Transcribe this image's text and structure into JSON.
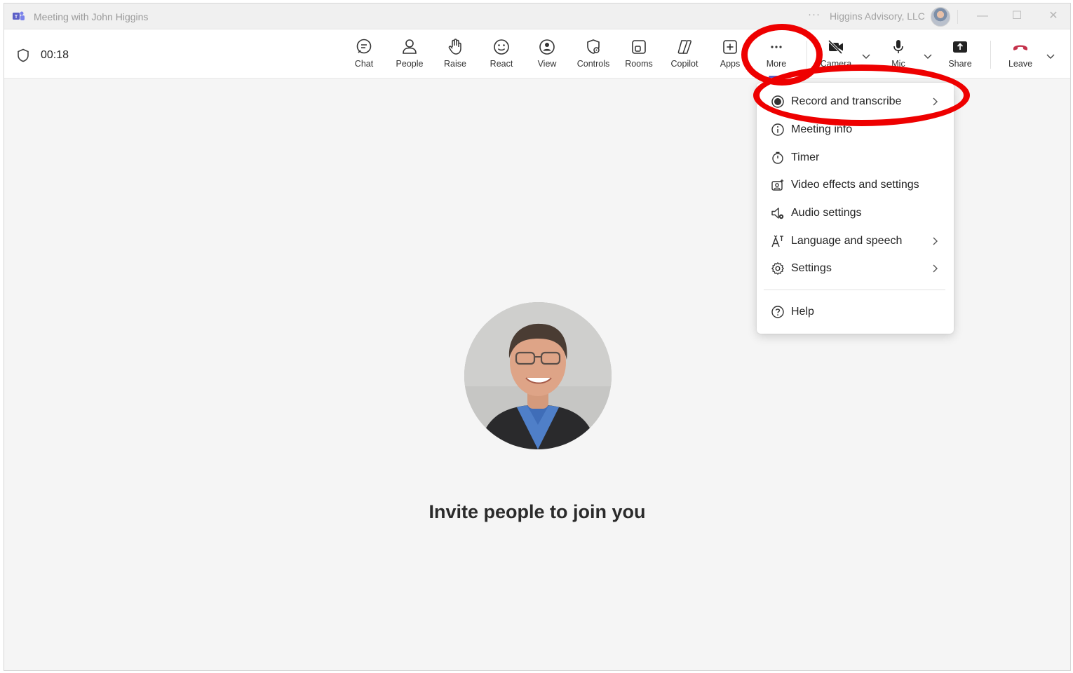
{
  "window": {
    "title": "Meeting with John Higgins",
    "org_more": "···",
    "org_name": "Higgins Advisory, LLC",
    "minimize": "—",
    "maximize": "☐",
    "close": "✕"
  },
  "toolbar": {
    "timer": "00:18",
    "items": [
      {
        "label": "Chat",
        "icon": "chat-icon"
      },
      {
        "label": "People",
        "icon": "people-icon"
      },
      {
        "label": "Raise",
        "icon": "raise-hand-icon"
      },
      {
        "label": "React",
        "icon": "smiley-icon"
      },
      {
        "label": "View",
        "icon": "view-icon"
      },
      {
        "label": "Controls",
        "icon": "controls-icon"
      },
      {
        "label": "Rooms",
        "icon": "rooms-icon"
      },
      {
        "label": "Copilot",
        "icon": "copilot-icon"
      },
      {
        "label": "Apps",
        "icon": "apps-icon"
      },
      {
        "label": "More",
        "icon": "more-icon"
      },
      {
        "label": "Camera",
        "icon": "camera-off-icon"
      },
      {
        "label": "Mic",
        "icon": "mic-icon"
      },
      {
        "label": "Share",
        "icon": "share-icon"
      },
      {
        "label": "Leave",
        "icon": "hang-up-icon"
      }
    ]
  },
  "menu": {
    "items": [
      {
        "label": "Record and transcribe",
        "icon": "record-icon",
        "submenu": true
      },
      {
        "label": "Meeting info",
        "icon": "info-icon",
        "submenu": false
      },
      {
        "label": "Timer",
        "icon": "stopwatch-icon",
        "submenu": false
      },
      {
        "label": "Video effects and settings",
        "icon": "video-effects-icon",
        "submenu": false
      },
      {
        "label": "Audio settings",
        "icon": "speaker-settings-icon",
        "submenu": false
      },
      {
        "label": "Language and speech",
        "icon": "language-icon",
        "submenu": true
      },
      {
        "label": "Settings",
        "icon": "gear-icon",
        "submenu": true
      },
      {
        "label": "Help",
        "icon": "help-icon",
        "submenu": false
      }
    ]
  },
  "stage": {
    "invite_text": "Invite people to join you"
  },
  "colors": {
    "accent": "#5b5fc7",
    "leave": "#c4314b",
    "annotation": "#ee0000"
  }
}
